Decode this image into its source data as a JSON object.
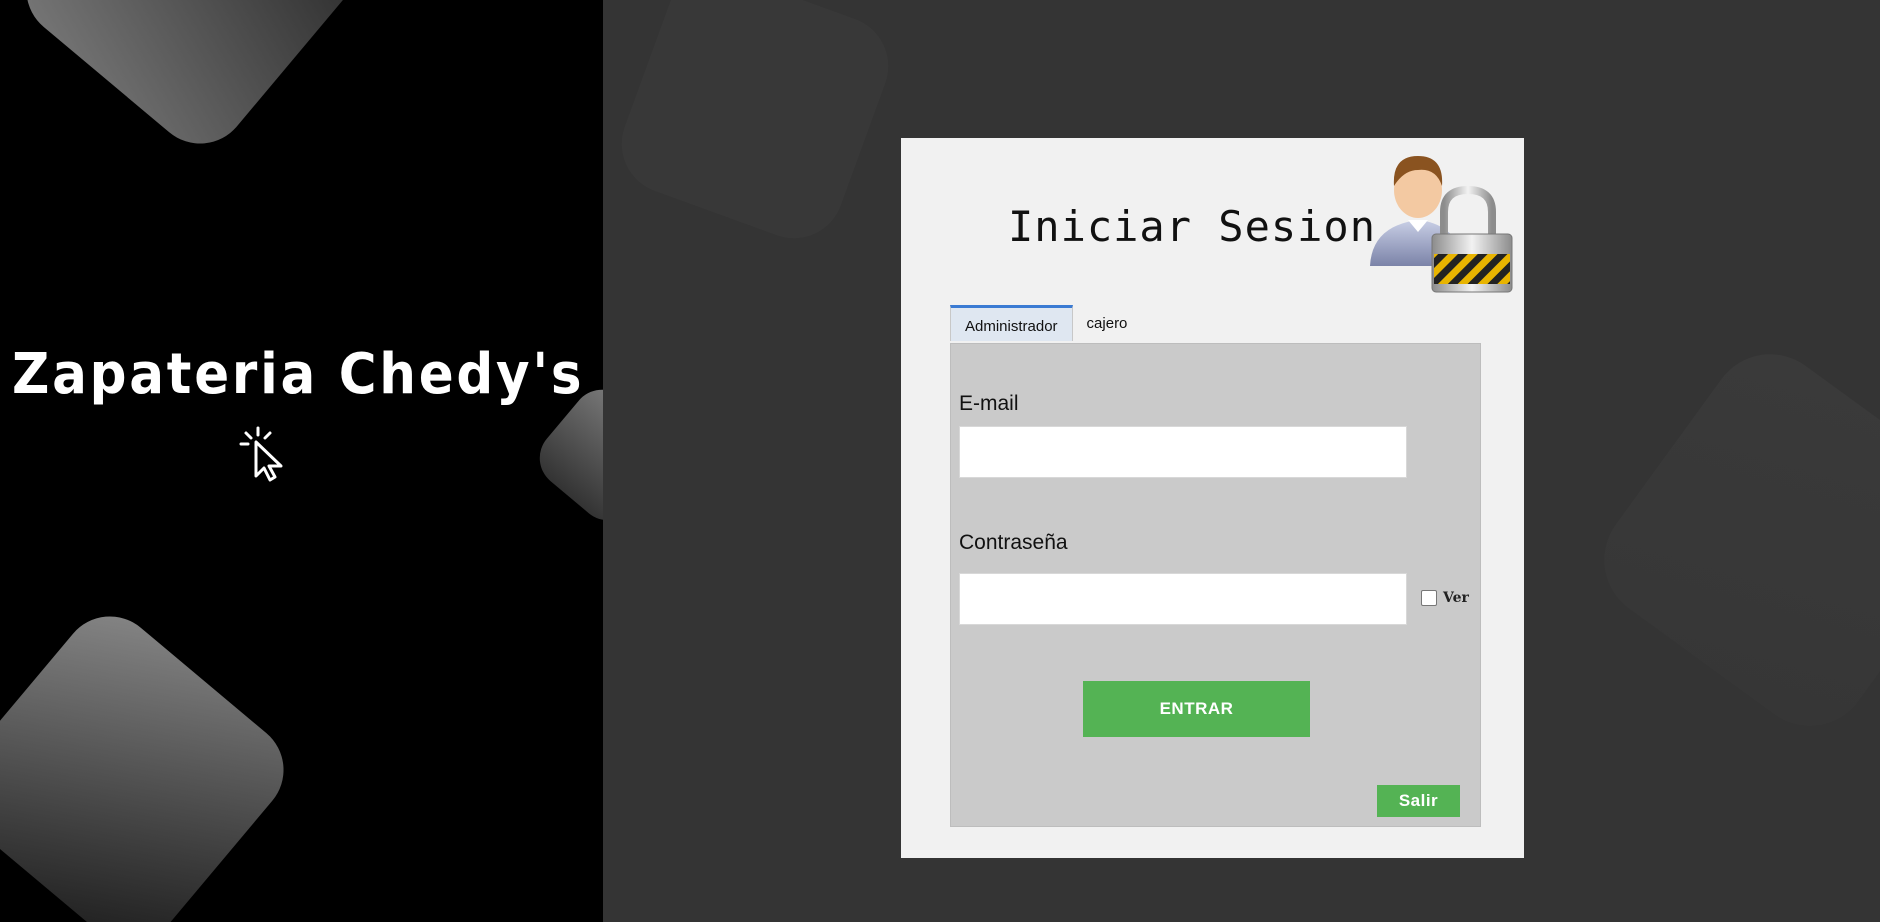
{
  "brand": {
    "title": "Zapateria Chedy's"
  },
  "login": {
    "title": "Iniciar Sesion",
    "tabs": [
      {
        "label": "Administrador",
        "active": true
      },
      {
        "label": "cajero",
        "active": false
      }
    ],
    "email_label": "E-mail",
    "email_value": "",
    "password_label": "Contraseña",
    "password_value": "",
    "show_password_label": "Ver",
    "show_password_checked": false,
    "submit_label": "ENTRAR",
    "exit_label": "Salir"
  },
  "colors": {
    "accent_green": "#54b354",
    "tab_active_border": "#3b7bd3",
    "left_panel": "#000000",
    "page_background": "#343434"
  },
  "icons": {
    "brand": "cursor-click-icon",
    "login": "user-lock-icon"
  }
}
